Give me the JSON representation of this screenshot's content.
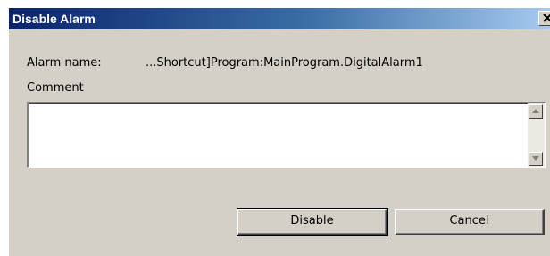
{
  "dialog": {
    "title": "Disable Alarm",
    "close_symbol": "X",
    "alarm_name_label": "Alarm name:",
    "alarm_name_value": "...Shortcut]Program:MainProgram.DigitalAlarm1",
    "comment_label": "Comment",
    "comment_value": "",
    "buttons": {
      "disable": "Disable",
      "cancel": "Cancel"
    }
  },
  "colors": {
    "title_bar_start": "#0a246a",
    "title_bar_end": "#a6caf0",
    "face": "#d4d0c8"
  },
  "icons": {
    "close": "close-icon",
    "scroll_up": "arrow-up-icon",
    "scroll_down": "arrow-down-icon"
  }
}
